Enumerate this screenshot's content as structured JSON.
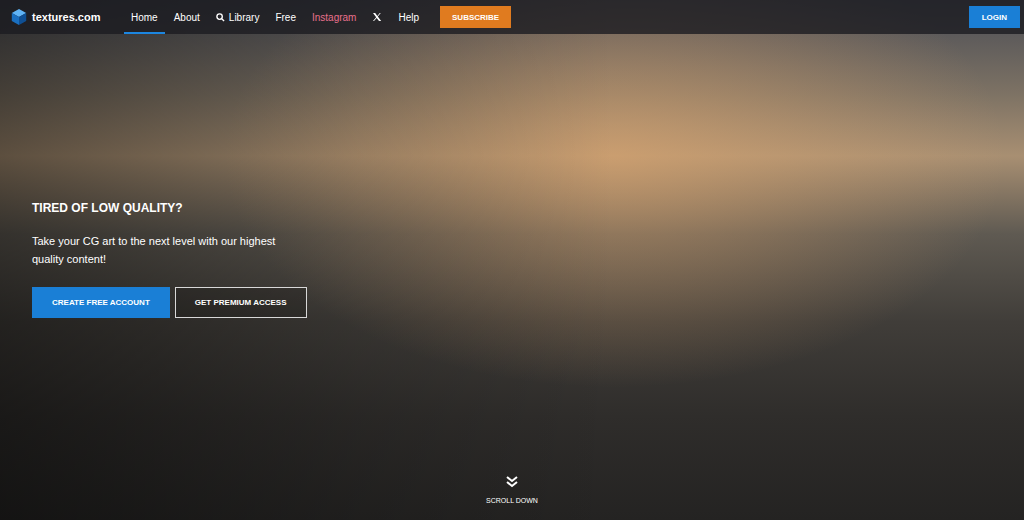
{
  "logo": {
    "text": "textures.com"
  },
  "nav": [
    {
      "label": "Home",
      "kind": "link",
      "selected": true,
      "color": "#ffffff"
    },
    {
      "label": "About",
      "kind": "link",
      "selected": false,
      "color": "#ffffff"
    },
    {
      "label": "Library",
      "kind": "search",
      "selected": false,
      "color": "#ffffff"
    },
    {
      "label": "Free",
      "kind": "link",
      "selected": false,
      "color": "#ffffff"
    },
    {
      "label": "Instagram",
      "kind": "link",
      "selected": false,
      "color": "#e8708c"
    },
    {
      "label": "",
      "kind": "x",
      "selected": false,
      "color": "#ffffff"
    },
    {
      "label": "Help",
      "kind": "link",
      "selected": false,
      "color": "#ffffff"
    }
  ],
  "subscribe": "SUBSCRIBE",
  "login": "LOGIN",
  "hero": {
    "title": "TIRED OF LOW QUALITY?",
    "subtitle": "Take your CG art to the next level with our highest quality content!",
    "buttons": [
      {
        "label": "CREATE FREE ACCOUNT",
        "kind": "primary"
      },
      {
        "label": "GET PREMIUM ACCESS",
        "kind": "outline"
      }
    ]
  },
  "scroll": {
    "label": "SCROLL DOWN"
  }
}
